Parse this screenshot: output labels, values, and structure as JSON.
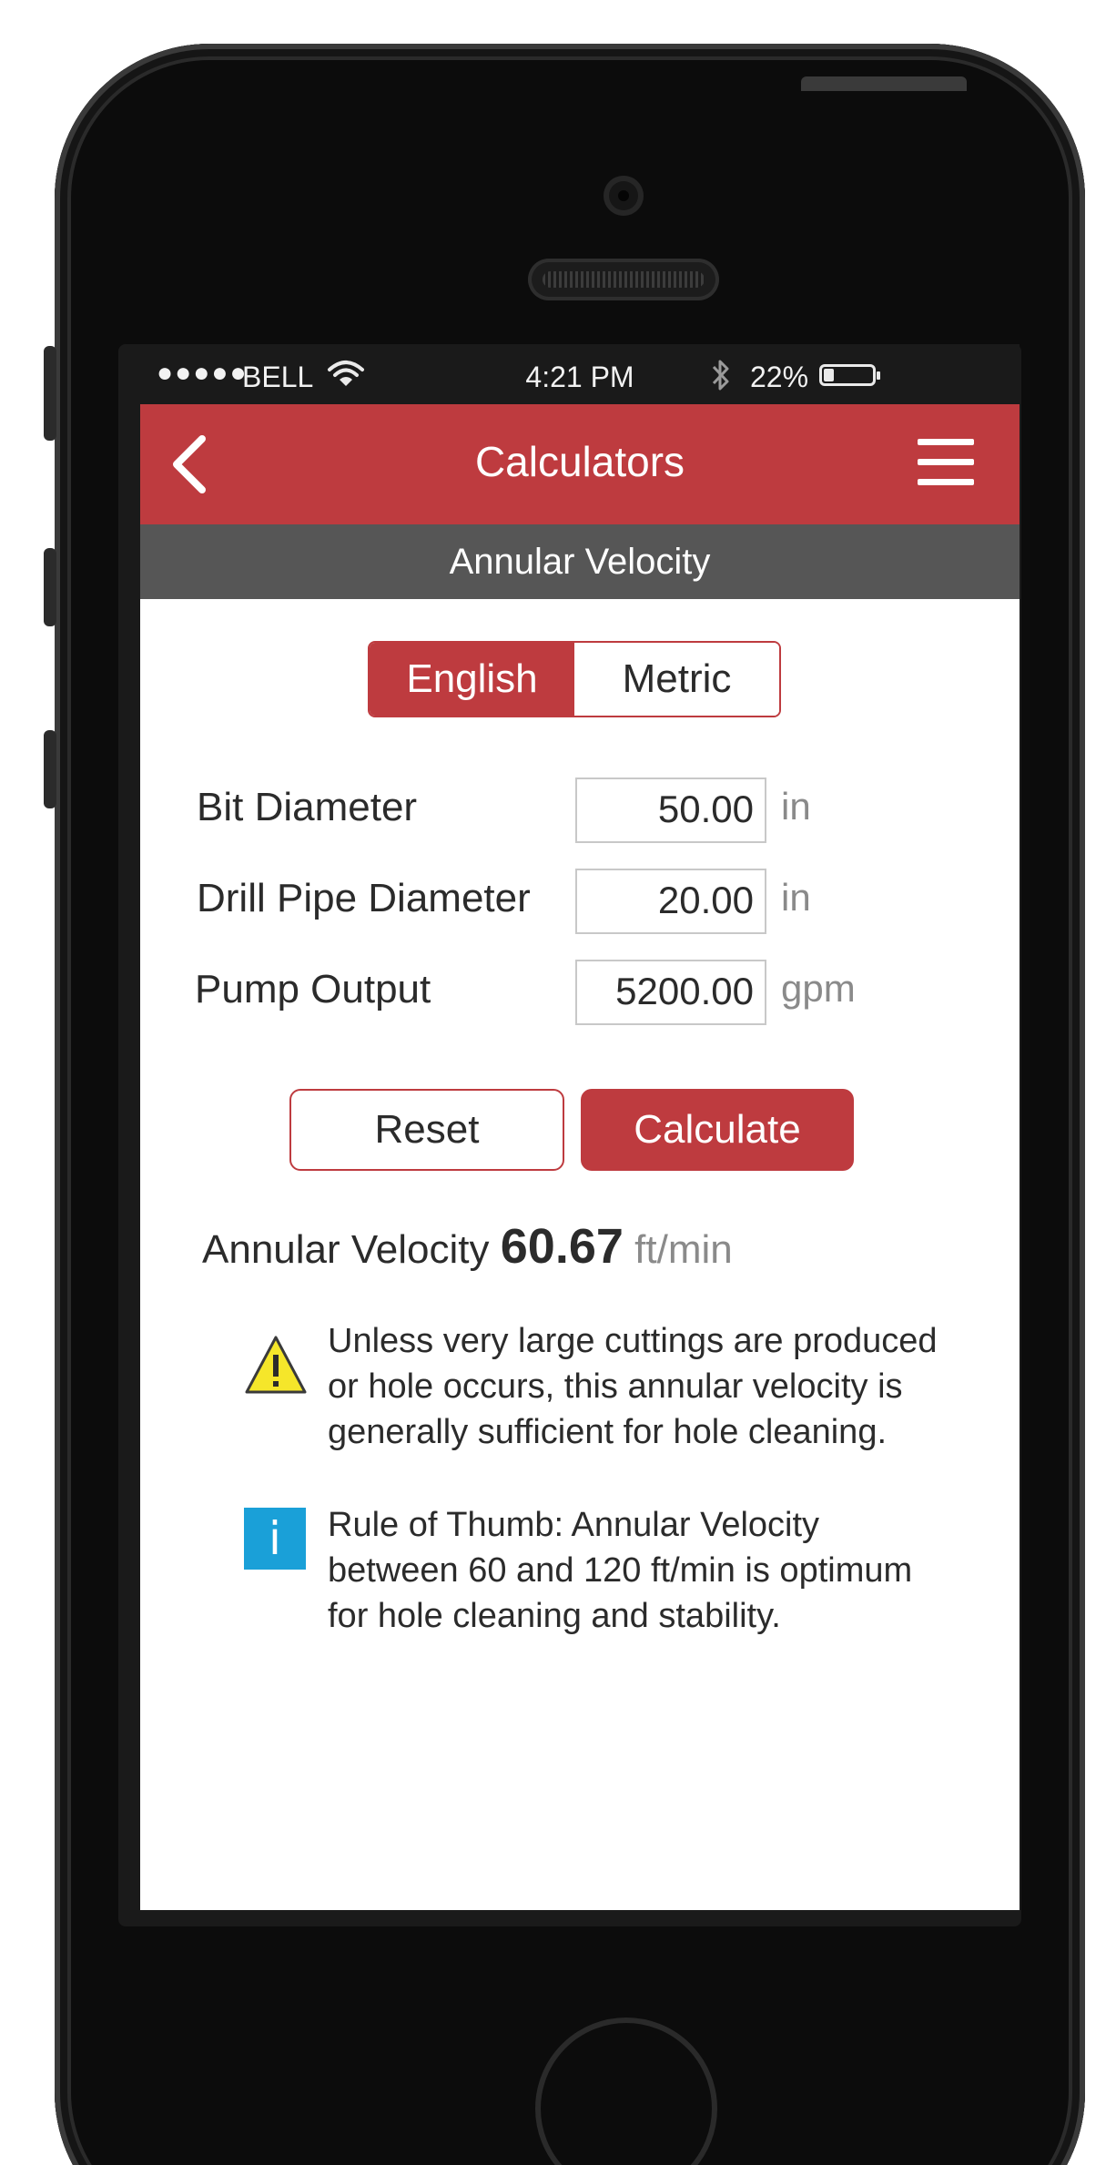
{
  "status_bar": {
    "signal_dots": "●●●●●",
    "carrier": "BELL",
    "time": "4:21 PM",
    "battery_percent": "22%",
    "battery_level": 0.22
  },
  "nav": {
    "title": "Calculators",
    "back_icon": "chevron-left-icon",
    "menu_icon": "hamburger-menu-icon"
  },
  "sub_header": {
    "title": "Annular Velocity"
  },
  "unit_toggle": {
    "options": [
      "English",
      "Metric"
    ],
    "selected": "English"
  },
  "fields": [
    {
      "label": "Bit Diameter",
      "value": "50.00",
      "unit": "in"
    },
    {
      "label": "Drill Pipe Diameter",
      "value": "20.00",
      "unit": "in"
    },
    {
      "label": "Pump Output",
      "value": "5200.00",
      "unit": "gpm"
    }
  ],
  "buttons": {
    "reset": "Reset",
    "calculate": "Calculate"
  },
  "result": {
    "label": "Annular Velocity",
    "value": "60.67",
    "unit": "ft/min"
  },
  "notes": {
    "warning": {
      "icon": "warning-icon",
      "lines": [
        "Unless very large cuttings are produced",
        "or hole occurs, this annular velocity is",
        "generally  sufficient  for hole cleaning."
      ]
    },
    "info": {
      "icon": "info-icon",
      "icon_glyph": "i",
      "lines": [
        "Rule of Thumb: Annular Velocity",
        "between 60 and 120 ft/min is optimum",
        "for hole  cleaning and stability."
      ]
    }
  },
  "colors": {
    "brand_red": "#be3b3f",
    "sub_header_gray": "#565656",
    "warning_yellow": "#f5e62a",
    "info_blue": "#1aa0d8"
  }
}
